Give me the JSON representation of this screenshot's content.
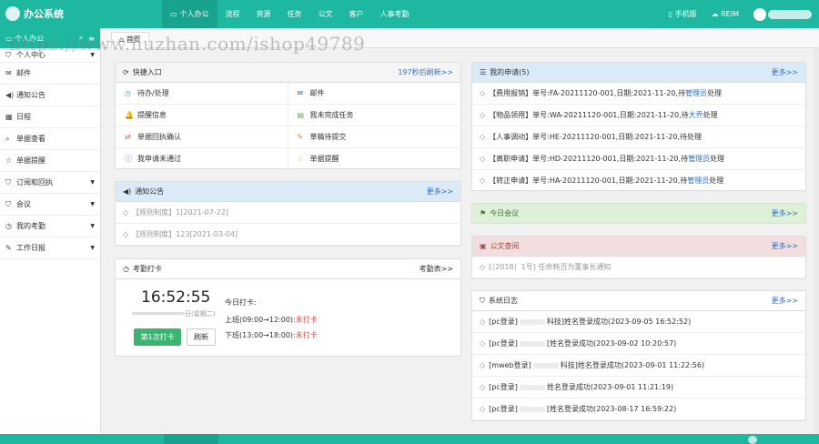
{
  "app": {
    "title": "办公系统"
  },
  "topnav": [
    {
      "label": "个人办公",
      "icon": "monitor-icon",
      "active": true
    },
    {
      "label": "流程"
    },
    {
      "label": "资源"
    },
    {
      "label": "任务"
    },
    {
      "label": "公文"
    },
    {
      "label": "客户"
    },
    {
      "label": "人事考勤"
    }
  ],
  "topright": {
    "mobile": "手机版",
    "reim": "REIM"
  },
  "sidebar": {
    "header": "个人办公",
    "items": [
      {
        "label": "个人中心",
        "icon": "bookmark-icon",
        "caret": true
      },
      {
        "label": "邮件",
        "icon": "envelope-icon"
      },
      {
        "label": "通知公告",
        "icon": "speaker-icon"
      },
      {
        "label": "日程",
        "icon": "calendar-icon"
      },
      {
        "label": "单据查看",
        "icon": "search-icon"
      },
      {
        "label": "单据提醒",
        "icon": "star-icon"
      },
      {
        "label": "订阅和回执",
        "icon": "bookmark-icon",
        "caret": true
      },
      {
        "label": "会议",
        "icon": "bookmark-icon",
        "caret": true
      },
      {
        "label": "我的考勤",
        "icon": "clock-icon",
        "caret": true
      },
      {
        "label": "工作日报",
        "icon": "edit-icon",
        "caret": true
      }
    ]
  },
  "tabs": {
    "home": "首页"
  },
  "watermark": "https://www.huzhan.com/ishop49789",
  "quick": {
    "title": "快捷入口",
    "refresh": "197秒后刷新>>",
    "items": [
      {
        "label": "待办/处理",
        "icon": "clock-icon",
        "color": "#5b9bd5"
      },
      {
        "label": "邮件",
        "icon": "envelope-icon",
        "color": "#2a6dc4"
      },
      {
        "label": "提醒信息",
        "icon": "bell-icon",
        "color": "#e6a23c"
      },
      {
        "label": "我未完成任务",
        "icon": "book-icon",
        "color": "#67a84b"
      },
      {
        "label": "单据回执确认",
        "icon": "exchange-icon",
        "color": "#d9534f"
      },
      {
        "label": "草稿待提交",
        "icon": "edit-icon",
        "color": "#e67e22"
      },
      {
        "label": "我申请未通过",
        "icon": "info-icon",
        "color": "#8e6bbf"
      },
      {
        "label": "单据提醒",
        "icon": "star-icon",
        "color": "#e6a23c"
      }
    ]
  },
  "notice": {
    "title": "通知公告",
    "more": "更多>>",
    "items": [
      "【规则制度】1[2021-07-22]",
      "【规则制度】123[2021-03-04]"
    ]
  },
  "attendance": {
    "title": "考勤打卡",
    "link": "考勤表>>",
    "time": "16:52:55",
    "date_tail": "日(星期二)",
    "today": "今日打卡:",
    "am_label": "上班(09:00→12:00):",
    "am_status": "未打卡",
    "pm_label": "下班(13:00→18:00):",
    "pm_status": "未打卡",
    "punch_btn": "第1次打卡",
    "refresh_btn": "刷新"
  },
  "myapply": {
    "title": "我的申请(5)",
    "more": "更多>>",
    "items": [
      {
        "pre": "【费用报销】单号:FA-20211120-001,日期:2021-11-20,",
        "wait": "待",
        "who": "管理员",
        "post": "处理"
      },
      {
        "pre": "【物品领用】单号:WA-20211120-001,日期:2021-11-20,",
        "wait": "待",
        "who": "大乔",
        "post": "处理"
      },
      {
        "pre": "【人事调动】单号:HE-20211120-001,日期:2021-11-20,",
        "wait": "",
        "who": "",
        "post": "待处理"
      },
      {
        "pre": "【离职申请】单号:HD-20211120-001,日期:2021-11-20,",
        "wait": "待",
        "who": "管理员",
        "post": "处理"
      },
      {
        "pre": "【转正申请】单号:HA-20211120-001,日期:2021-11-20,",
        "wait": "待",
        "who": "管理员",
        "post": "处理"
      }
    ]
  },
  "meeting": {
    "title": "今日会议",
    "more": "更多>>"
  },
  "docs": {
    "title": "公文查阅",
    "more": "更多>>",
    "items": [
      "[〔2018〕1号] 任命韩百为董事长通知"
    ]
  },
  "syslog": {
    "title": "系统日志",
    "more": "更多>>",
    "items": [
      {
        "tag": "[pc登录]",
        "mid": "科技]",
        "text": "姓名登录成功(2023-09-05 16:52:52)"
      },
      {
        "tag": "[pc登录]",
        "mid": "[",
        "text": "姓名登录成功(2023-09-02 10:20:57)"
      },
      {
        "tag": "[mweb登录]",
        "mid": "科技]",
        "text": "姓名登录成功(2023-09-01 11:22:56)"
      },
      {
        "tag": "[pc登录]",
        "mid": "",
        "text": "姓名登录成功(2023-09-01 11:21:19)"
      },
      {
        "tag": "[pc登录]",
        "mid": "[",
        "text": "姓名登录成功(2023-08-17 16:59:22)"
      }
    ]
  }
}
